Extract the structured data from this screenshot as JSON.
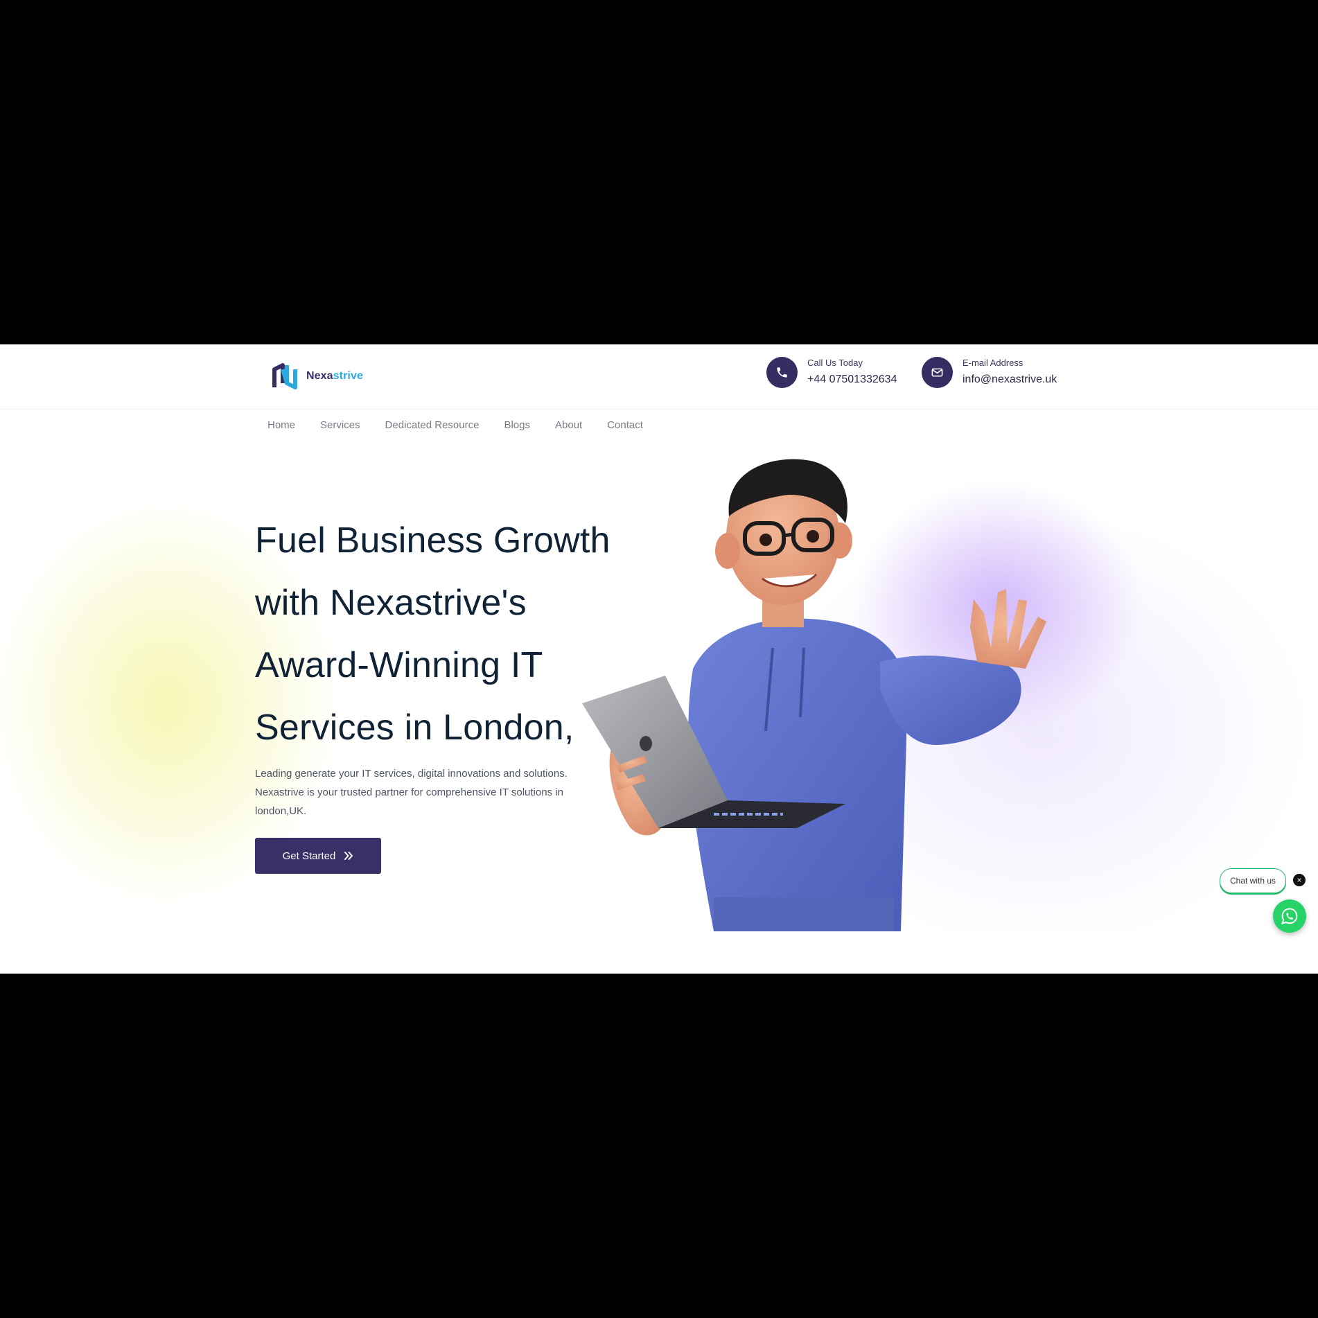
{
  "brand": {
    "name_primary": "Nexa",
    "name_accent": "strive",
    "primary_color": "#352e63",
    "accent_color": "#2aa8e0"
  },
  "contact": {
    "phone_label": "Call Us Today",
    "phone_value": "+44 07501332634",
    "email_label": "E-mail Address",
    "email_value": "info@nexastrive.uk"
  },
  "nav": {
    "items": [
      {
        "label": "Home"
      },
      {
        "label": "Services"
      },
      {
        "label": "Dedicated Resource"
      },
      {
        "label": "Blogs"
      },
      {
        "label": "About"
      },
      {
        "label": "Contact"
      }
    ]
  },
  "hero": {
    "title_line1": "Fuel Business Growth",
    "title_line2": "with Nexastrive's",
    "title_line3": "Award-Winning IT",
    "title_line4": "Services in London,",
    "description_line1": "Leading generate your IT services, digital innovations and solutions.",
    "description_line2": "Nexastrive is your trusted partner for comprehensive IT solutions in",
    "description_line3": "london,UK.",
    "cta_label": "Get Started"
  },
  "chat_widget": {
    "bubble_text": "Chat with us",
    "close_symbol": "×",
    "button_color": "#25d366",
    "icon": "whatsapp-icon"
  },
  "icons": {
    "phone": "phone-icon",
    "email": "envelope-icon",
    "cta": "double-chevron-right-icon"
  }
}
